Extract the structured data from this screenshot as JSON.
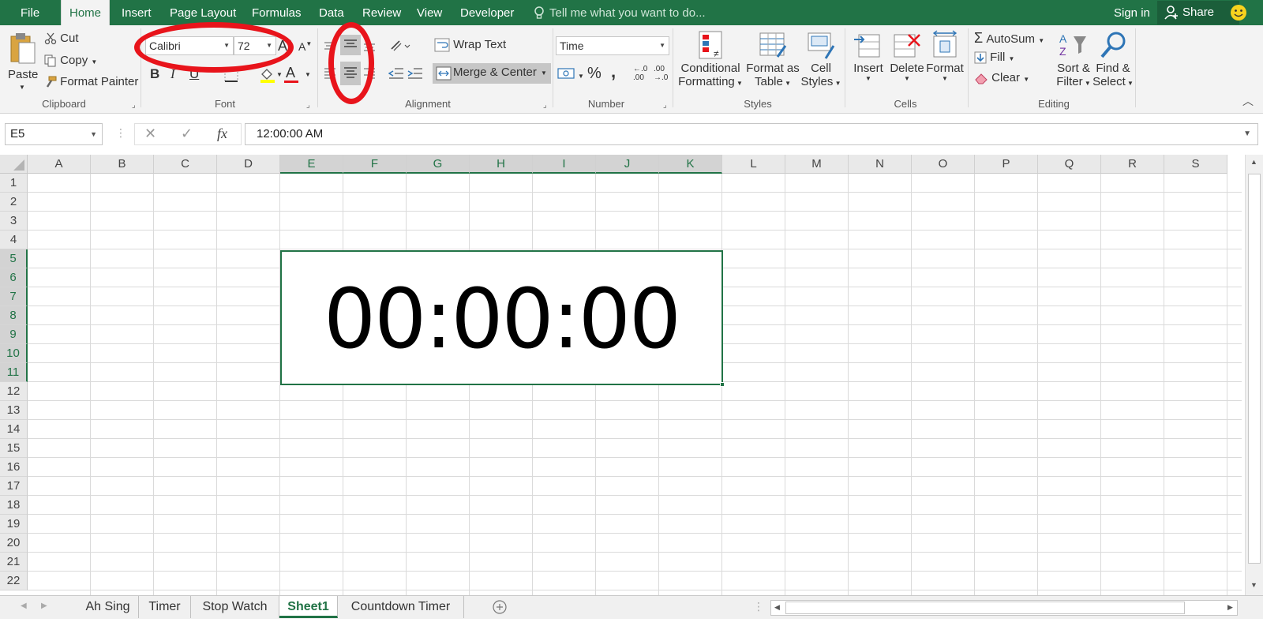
{
  "tabs": {
    "file": "File",
    "home": "Home",
    "insert": "Insert",
    "page_layout": "Page Layout",
    "formulas": "Formulas",
    "data": "Data",
    "review": "Review",
    "view": "View",
    "developer": "Developer",
    "tell_me": "Tell me what you want to do...",
    "sign_in": "Sign in",
    "share": "Share"
  },
  "ribbon": {
    "clipboard": {
      "label": "Clipboard",
      "paste": "Paste",
      "cut": "Cut",
      "copy": "Copy",
      "format_painter": "Format Painter"
    },
    "font": {
      "label": "Font",
      "name": "Calibri",
      "size": "72",
      "bold": "B",
      "italic": "I",
      "underline": "U",
      "font_color_glyph": "A"
    },
    "alignment": {
      "label": "Alignment",
      "wrap_text": "Wrap Text",
      "merge_center": "Merge & Center"
    },
    "number": {
      "label": "Number",
      "format": "Time",
      "percent": "%",
      "comma": ",",
      "inc_decimal_top": "←.0",
      "inc_decimal_bottom": ".00",
      "dec_decimal_top": ".00",
      "dec_decimal_bottom": "→.0"
    },
    "styles": {
      "label": "Styles",
      "conditional_line1": "Conditional",
      "conditional_line2": "Formatting",
      "format_table_line1": "Format as",
      "format_table_line2": "Table",
      "cell_styles_line1": "Cell",
      "cell_styles_line2": "Styles"
    },
    "cells": {
      "label": "Cells",
      "insert": "Insert",
      "delete": "Delete",
      "format": "Format"
    },
    "editing": {
      "label": "Editing",
      "autosum": "AutoSum",
      "fill": "Fill",
      "clear": "Clear",
      "sort_line1": "Sort &",
      "sort_line2": "Filter",
      "find_line1": "Find &",
      "find_line2": "Select"
    }
  },
  "formula_bar": {
    "name_box": "E5",
    "fx": "fx",
    "value": "12:00:00 AM"
  },
  "grid": {
    "columns": [
      "A",
      "B",
      "C",
      "D",
      "E",
      "F",
      "G",
      "H",
      "I",
      "J",
      "K",
      "L",
      "M",
      "N",
      "O",
      "P",
      "Q",
      "R",
      "S"
    ],
    "selected_columns": [
      "E",
      "F",
      "G",
      "H",
      "I",
      "J",
      "K"
    ],
    "rows": [
      "1",
      "2",
      "3",
      "4",
      "5",
      "6",
      "7",
      "8",
      "9",
      "10",
      "11",
      "12",
      "13",
      "14",
      "15",
      "16",
      "17",
      "18",
      "19",
      "20",
      "21",
      "22"
    ],
    "selected_rows": [
      "5",
      "6",
      "7",
      "8",
      "9",
      "10",
      "11"
    ],
    "merged_cell_display": "00:00:00"
  },
  "sheets": {
    "tabs": [
      "Ah Sing",
      "Timer",
      "Stop Watch",
      "Sheet1",
      "Countdown Timer"
    ],
    "active": "Sheet1"
  },
  "colors": {
    "excel_green": "#217346",
    "highlight_red": "#e8141b"
  }
}
